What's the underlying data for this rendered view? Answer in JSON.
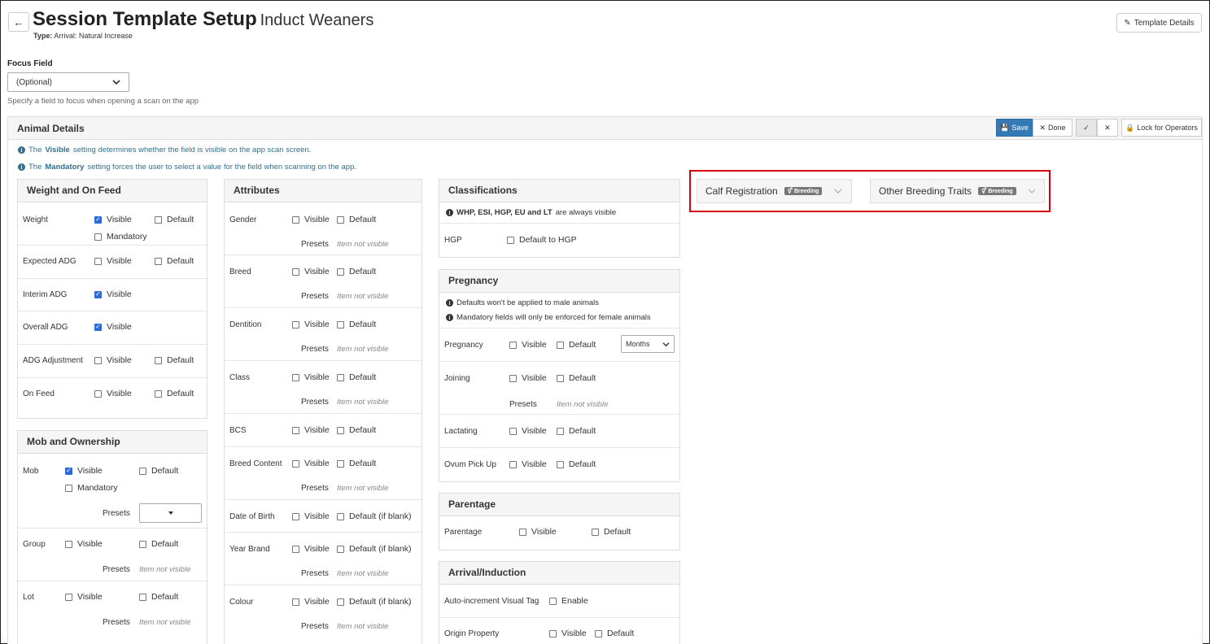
{
  "header": {
    "back_icon": "arrow-left-icon",
    "title": "Session Template Setup",
    "subtitle": "Induct Weaners",
    "type_label": "Type:",
    "type_value": "Arrival: Natural Increase",
    "template_details_label": "Template Details",
    "template_details_icon": "pencil-icon"
  },
  "focus": {
    "label": "Focus Field",
    "value": "(Optional)",
    "help": "Specify a field to focus when opening a scan on the app"
  },
  "animal": {
    "title": "Animal Details",
    "toolbar": {
      "save": "Save",
      "done": "Done",
      "lock": "Lock for Operators"
    },
    "info1_pre": "The",
    "info1_bold": "Visible",
    "info1_post": "setting determines whether the field is visible on the app scan screen.",
    "info2_pre": "The",
    "info2_bold": "Mandatory",
    "info2_post": "setting forces the user to select a value for the field when scanning on the app."
  },
  "labels": {
    "visible": "Visible",
    "default": "Default",
    "mandatory": "Mandatory",
    "presets": "Presets",
    "not_visible": "Item not visible",
    "default_if_blank": "Default (if blank)",
    "default_to_hgp": "Default to HGP",
    "enable": "Enable"
  },
  "weight": {
    "title": "Weight and On Feed",
    "rows": [
      "Weight",
      "Expected ADG",
      "Interim ADG",
      "Overall ADG",
      "ADG Adjustment",
      "On Feed"
    ]
  },
  "mob": {
    "title": "Mob and Ownership",
    "rows": [
      "Mob",
      "Group",
      "Lot"
    ]
  },
  "attributes": {
    "title": "Attributes",
    "rows": [
      "Gender",
      "Breed",
      "Dentition",
      "Class",
      "BCS",
      "Breed Content",
      "Date of Birth",
      "Year Brand",
      "Colour"
    ]
  },
  "classifications": {
    "title": "Classifications",
    "note_bold": "WHP, ESI, HGP, EU and LT",
    "note_post": "are always visible",
    "hgp": "HGP"
  },
  "pregnancy": {
    "title": "Pregnancy",
    "note1": "Defaults won't be applied to male animals",
    "note2": "Mandatory fields will only be enforced for female animals",
    "rows": [
      "Pregnancy",
      "Joining",
      "Lactating",
      "Ovum Pick Up"
    ],
    "unit": "Months"
  },
  "parentage": {
    "title": "Parentage",
    "row": "Parentage"
  },
  "arrival": {
    "title": "Arrival/Induction",
    "auto": "Auto-increment Visual Tag",
    "origin": "Origin Property"
  },
  "breeding": {
    "calf": "Calf Registration",
    "other": "Other Breeding Traits",
    "badge": "Breeding"
  },
  "colors": {
    "accent": "#337ab7",
    "checkbox": "#2f6bd6",
    "highlight": "#d9000d"
  }
}
